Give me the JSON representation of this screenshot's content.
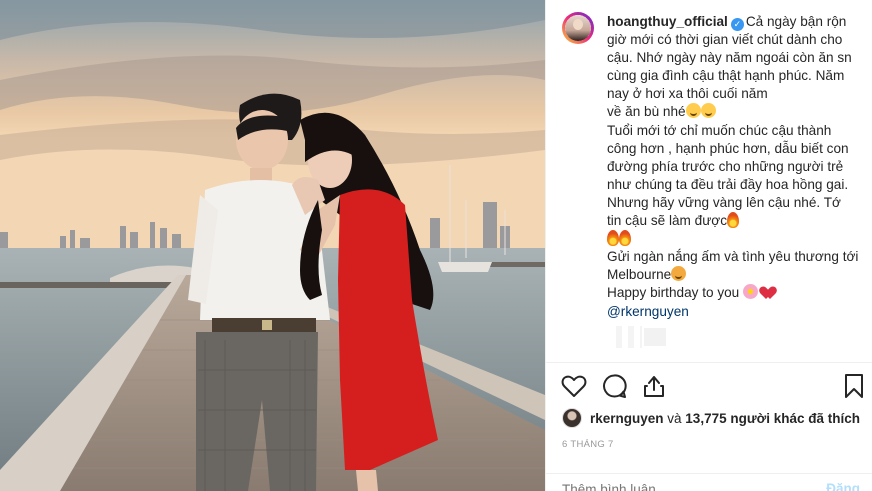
{
  "post": {
    "username": "hoangthuy_official",
    "verified_icon": "verified-badge-icon",
    "caption_lines": [
      "Cả ngày bận rộn",
      "giờ mới có thời gian viết chút dành",
      "cho cậu. Nhớ ngày này năm ngoái còn",
      "ăn sn cùng gia đình cậu thật hạnh",
      "phúc. Năm nay ở hơi xa thôi cuối năm",
      "về ăn bù nhé",
      "Tuổi mới tớ chỉ muốn chúc cậu thành",
      "công hơn , hạnh phúc hơn, dẫu biết",
      "con đường phía trước cho những",
      "người trẻ như chúng ta đều trải đầy",
      "hoa hồng gai. Nhưng hãy vững vàng",
      "lên cậu nhé. Tớ tin cậu sẽ làm được",
      "",
      "Gửi ngàn nắng ấm và tình yêu thương",
      "tới Melbourne",
      "Happy birthday to you"
    ],
    "mention": "@rkernguyen"
  },
  "likes": {
    "liker": "rkernguyen",
    "middle": " và ",
    "count": "13,775",
    "suffix": " người khác đã thích"
  },
  "timestamp": "6 THÁNG 7",
  "comment": {
    "placeholder": "Thêm bình luận...",
    "post_label": "Đăng"
  },
  "icons": {
    "like": "heart-outline-icon",
    "comment": "comment-bubble-icon",
    "share": "share-icon",
    "save": "bookmark-icon"
  },
  "colors": {
    "text": "#262626",
    "secondary": "#999999",
    "link": "#003569",
    "verified": "#3897f0",
    "post_button": "#b2dffc"
  }
}
